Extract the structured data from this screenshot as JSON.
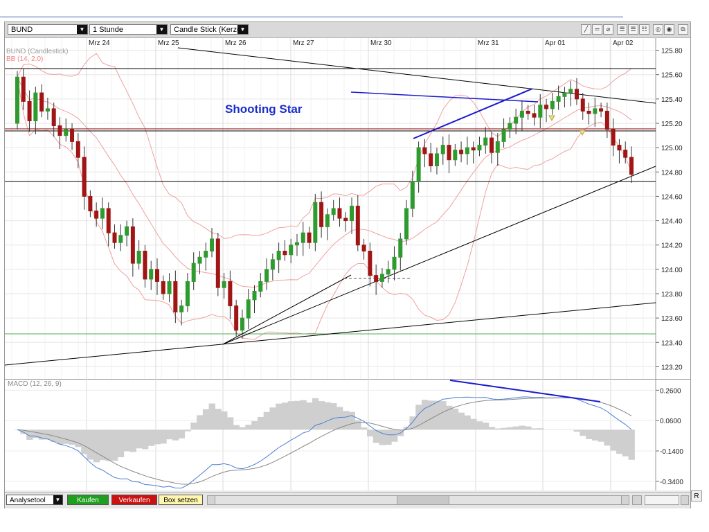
{
  "toolbar": {
    "symbol": "BUND",
    "interval": "1 Stunde",
    "chart_type": "Candle Stick (Kerze"
  },
  "chart": {
    "legend_symbol": "BUND (Candlestick)",
    "legend_bb": "BB (14, 2.0)",
    "annotation": "Shooting Star",
    "date_labels": [
      "Mrz 24",
      "Mrz 25",
      "Mrz 26",
      "Mrz 27",
      "Mrz 30",
      "Mrz 31",
      "Apr 01",
      "Apr 02"
    ],
    "price_labels": [
      "125.80",
      "125.60",
      "125.40",
      "125.20",
      "125.00",
      "124.80",
      "124.60",
      "124.40",
      "124.20",
      "124.00",
      "123.80",
      "123.60",
      "123.40",
      "123.20"
    ],
    "up_color": "#2e9b2e",
    "down_color": "#a11515",
    "band_color": "#f0a0a0"
  },
  "macd": {
    "legend": "MACD (12, 26, 9)",
    "labels": [
      "0.2600",
      "0.0600",
      "-0.1400",
      "-0.3400"
    ]
  },
  "bottom": {
    "tool": "Analysetool",
    "buy": "Kaufen",
    "sell": "Verkaufen",
    "box": "Box setzen",
    "reset": "R"
  },
  "chart_data": {
    "type": "candlestick",
    "title": "BUND (Candlestick)",
    "interval": "1 Stunde",
    "x_labels": [
      "Mrz 24",
      "Mrz 25",
      "Mrz 26",
      "Mrz 27",
      "Mrz 30",
      "Mrz 31",
      "Apr 01",
      "Apr 02"
    ],
    "ylim": [
      123.1,
      125.9
    ],
    "indicators": [
      "BB (14, 2.0)",
      "MACD (12, 26, 9)"
    ],
    "close": [
      125.58,
      125.38,
      125.22,
      125.45,
      125.3,
      125.32,
      125.18,
      125.1,
      125.15,
      125.05,
      124.92,
      124.6,
      124.48,
      124.42,
      124.5,
      124.3,
      124.22,
      124.28,
      124.35,
      124.05,
      124.15,
      123.92,
      124.0,
      123.9,
      123.8,
      123.9,
      123.65,
      123.7,
      123.9,
      124.05,
      124.1,
      124.15,
      124.25,
      123.85,
      123.9,
      123.7,
      123.5,
      123.6,
      123.75,
      123.82,
      123.9,
      124.0,
      124.08,
      124.15,
      124.12,
      124.2,
      124.22,
      124.3,
      124.22,
      124.55,
      124.35,
      124.45,
      124.5,
      124.42,
      124.4,
      124.52,
      124.2,
      124.15,
      123.95,
      123.9,
      123.96,
      124.0,
      124.1,
      124.25,
      124.5,
      124.72,
      125.0,
      124.95,
      124.85,
      124.95,
      125.02,
      124.9,
      124.98,
      124.95,
      125.0,
      124.98,
      125.02,
      125.08,
      124.96,
      125.05,
      125.15,
      125.2,
      125.25,
      125.3,
      125.28,
      125.25,
      125.35,
      125.32,
      125.38,
      125.42,
      125.45,
      125.48,
      125.4,
      125.3,
      125.28,
      125.32,
      125.3,
      125.15,
      125.02,
      124.98,
      124.92,
      124.78
    ],
    "open": [
      125.2,
      125.58,
      125.38,
      125.22,
      125.45,
      125.3,
      125.32,
      125.18,
      125.1,
      125.15,
      125.05,
      124.92,
      124.6,
      124.48,
      124.42,
      124.5,
      124.3,
      124.22,
      124.28,
      124.35,
      124.05,
      124.15,
      123.92,
      124.0,
      123.9,
      123.8,
      123.9,
      123.65,
      123.7,
      123.9,
      124.05,
      124.1,
      124.15,
      124.25,
      123.85,
      123.9,
      123.7,
      123.5,
      123.6,
      123.75,
      123.82,
      123.9,
      124.0,
      124.08,
      124.15,
      124.12,
      124.2,
      124.22,
      124.3,
      124.22,
      124.55,
      124.35,
      124.45,
      124.5,
      124.42,
      124.4,
      124.52,
      124.2,
      124.15,
      123.95,
      123.9,
      123.96,
      124.0,
      124.1,
      124.25,
      124.5,
      124.72,
      125.0,
      124.95,
      124.85,
      124.95,
      125.02,
      124.9,
      124.98,
      124.95,
      125.0,
      124.98,
      125.02,
      125.08,
      124.96,
      125.05,
      125.15,
      125.2,
      125.25,
      125.3,
      125.28,
      125.25,
      125.35,
      125.32,
      125.38,
      125.42,
      125.45,
      125.48,
      125.4,
      125.3,
      125.28,
      125.32,
      125.3,
      125.15,
      125.02,
      124.98,
      124.92
    ]
  }
}
